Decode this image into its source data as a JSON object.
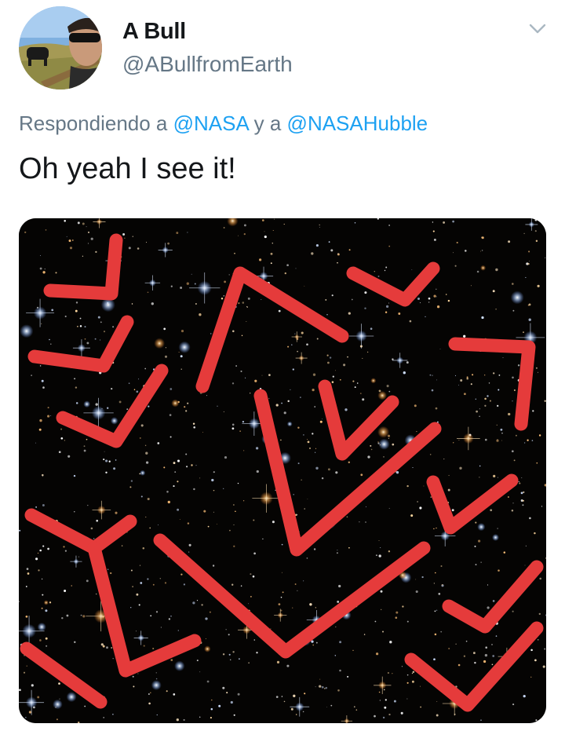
{
  "tweet": {
    "display_name": "A Bull",
    "handle": "@ABullfromEarth",
    "reply_context": {
      "prefix": "Respondiendo a",
      "mention_1": "@NASA",
      "joiner": "y a",
      "mention_2": "@NASAHubble"
    },
    "text": "Oh yeah I see it!"
  },
  "icons": {
    "caret": "chevron-down-icon",
    "avatar": "profile-photo"
  },
  "colors": {
    "link": "#1da1f2",
    "secondary_text": "#657786",
    "primary_text": "#14171a",
    "annotation_stroke": "#e53b3b",
    "sky": "#050403"
  }
}
